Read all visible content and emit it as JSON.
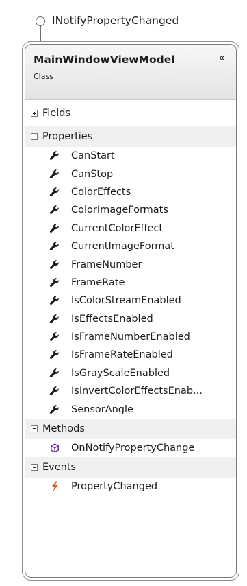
{
  "interface": {
    "name": "INotifyPropertyChanged"
  },
  "class": {
    "name": "MainWindowViewModel",
    "stereotype": "Class",
    "collapse_glyph": "«"
  },
  "sections": {
    "fields": {
      "label": "Fields",
      "expanded": false
    },
    "properties": {
      "label": "Properties",
      "expanded": true,
      "icon": "wrench-icon",
      "items": [
        "CanStart",
        "CanStop",
        "ColorEffects",
        "ColorImageFormats",
        "CurrentColorEffect",
        "CurrentImageFormat",
        "FrameNumber",
        "FrameRate",
        "IsColorStreamEnabled",
        "IsEffectsEnabled",
        "IsFrameNumberEnabled",
        "IsFrameRateEnabled",
        "IsGrayScaleEnabled",
        "IsInvertColorEffectsEnab...",
        "SensorAngle"
      ]
    },
    "methods": {
      "label": "Methods",
      "expanded": true,
      "icon": "method-cube-icon",
      "items": [
        "OnNotifyPropertyChange"
      ]
    },
    "events": {
      "label": "Events",
      "expanded": true,
      "icon": "lightning-icon",
      "items": [
        "PropertyChanged"
      ]
    }
  },
  "colors": {
    "method_icon": "#6c2ea7",
    "event_icon": "#e8541b",
    "property_icon": "#1a1a1a"
  }
}
